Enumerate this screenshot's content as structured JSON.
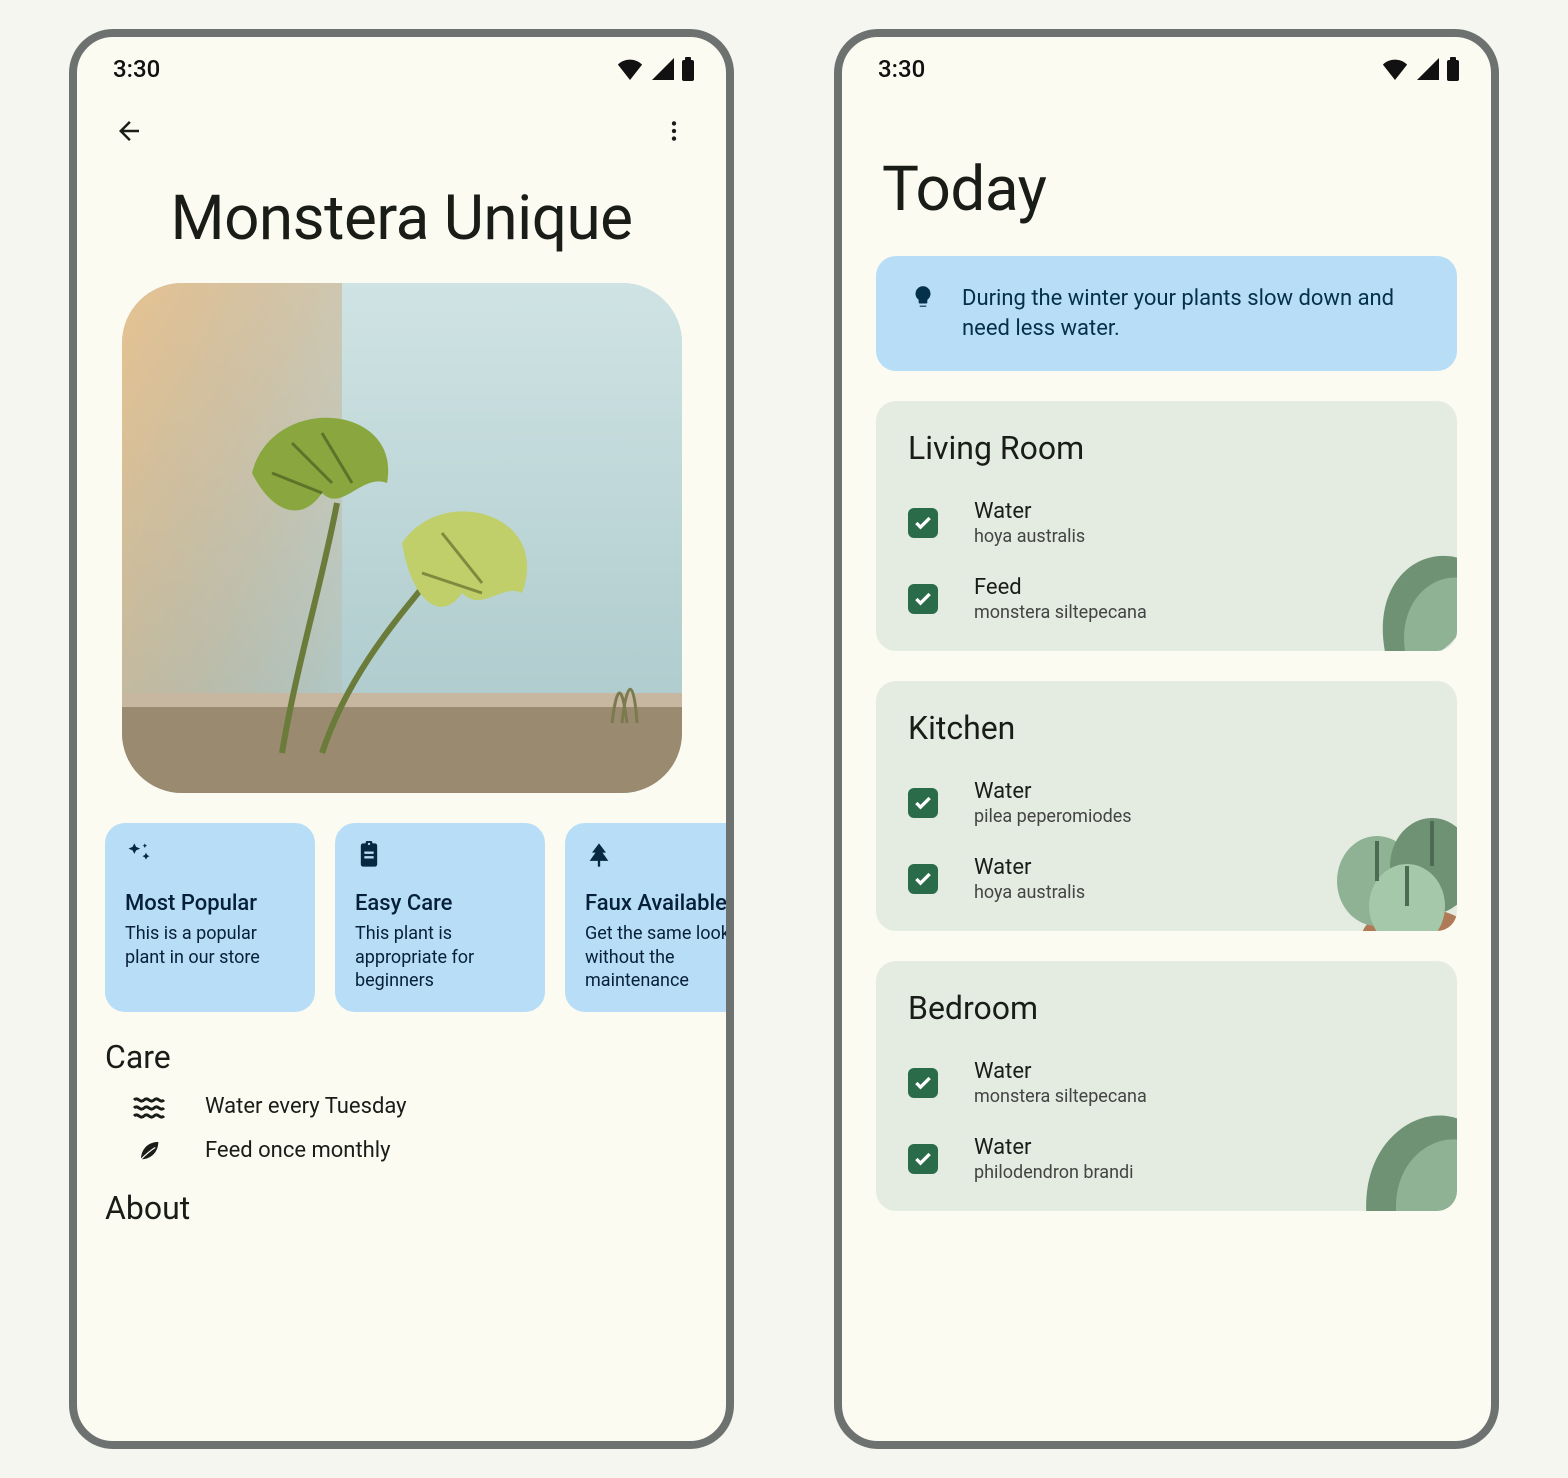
{
  "status": {
    "time": "3:30"
  },
  "screen1": {
    "title": "Monstera Unique",
    "chips": [
      {
        "title": "Most Popular",
        "desc": "This is a popular plant in our store"
      },
      {
        "title": "Easy Care",
        "desc": "This plant is appropriate for beginners"
      },
      {
        "title": "Faux Available",
        "desc": "Get the same look without the maintenance"
      }
    ],
    "care_header": "Care",
    "care": [
      {
        "text": "Water every Tuesday"
      },
      {
        "text": "Feed once monthly"
      }
    ],
    "about_header": "About"
  },
  "screen2": {
    "title": "Today",
    "tip": "During the winter your plants slow down and need less water.",
    "rooms": [
      {
        "name": "Living Room",
        "tasks": [
          {
            "action": "Water",
            "plant": "hoya australis",
            "checked": true
          },
          {
            "action": "Feed",
            "plant": "monstera siltepecana",
            "checked": true
          }
        ]
      },
      {
        "name": "Kitchen",
        "tasks": [
          {
            "action": "Water",
            "plant": "pilea peperomiodes",
            "checked": true
          },
          {
            "action": "Water",
            "plant": "hoya australis",
            "checked": true
          }
        ]
      },
      {
        "name": "Bedroom",
        "tasks": [
          {
            "action": "Water",
            "plant": "monstera siltepecana",
            "checked": true
          },
          {
            "action": "Water",
            "plant": "philodendron brandi",
            "checked": true
          }
        ]
      }
    ]
  }
}
